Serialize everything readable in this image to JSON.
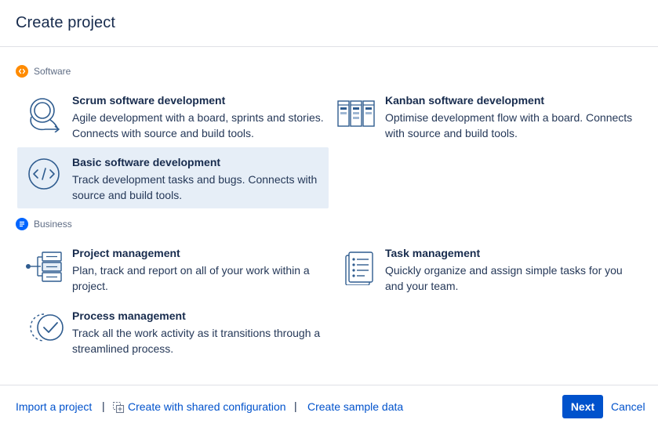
{
  "dialog": {
    "title": "Create project"
  },
  "sections": [
    {
      "label": "Software",
      "icon": "code-badge-icon",
      "color": "#ff8b00",
      "templates": [
        {
          "name": "Scrum software development",
          "description": "Agile development with a board, sprints and stories. Connects with source and build tools.",
          "icon": "scrum-cycle-icon"
        },
        {
          "name": "Kanban software development",
          "description": "Optimise development flow with a board. Connects with source and build tools.",
          "icon": "kanban-board-icon"
        },
        {
          "name": "Basic software development",
          "description": "Track development tasks and bugs. Connects with source and build tools.",
          "icon": "code-circle-icon",
          "selected": true
        }
      ]
    },
    {
      "label": "Business",
      "icon": "list-badge-icon",
      "color": "#0065ff",
      "templates": [
        {
          "name": "Project management",
          "description": "Plan, track and report on all of your work within a project.",
          "icon": "project-tree-icon"
        },
        {
          "name": "Task management",
          "description": "Quickly organize and assign simple tasks for you and your team.",
          "icon": "task-list-icon"
        },
        {
          "name": "Process management",
          "description": "Track all the work activity as it transitions through a streamlined process.",
          "icon": "process-check-icon"
        }
      ]
    }
  ],
  "footer": {
    "import_label": "Import a project",
    "separator": "|",
    "shared_config_label": "Create with shared configuration",
    "shared_config_icon": "shared-config-icon",
    "sample_data_label": "Create sample data",
    "next_label": "Next",
    "cancel_label": "Cancel"
  },
  "colors": {
    "primary": "#0052cc",
    "selected_bg": "#e6eef7",
    "icon_blue": "#2f5c8f",
    "text": "#172b4d",
    "subtle_text": "#5e6c84"
  }
}
